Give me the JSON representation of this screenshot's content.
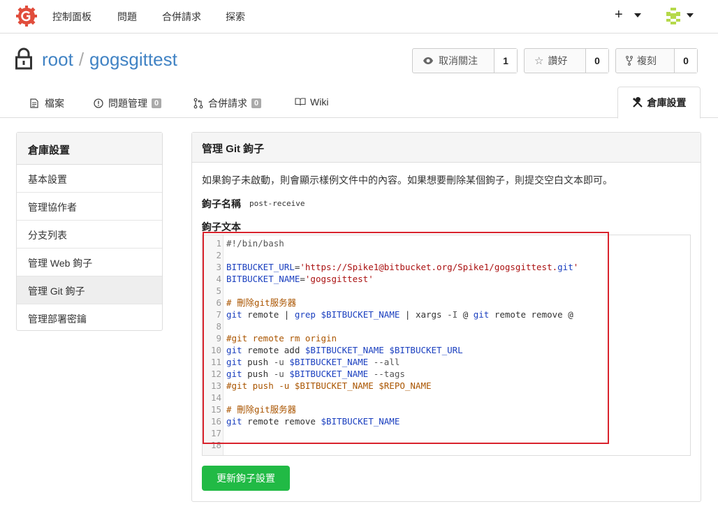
{
  "nav": {
    "items": [
      "控制面板",
      "問題",
      "合併請求",
      "探索"
    ],
    "plus_label": "+"
  },
  "repo": {
    "owner": "root",
    "separator": "/",
    "name": "gogsgittest",
    "watch": {
      "label": "取消關注",
      "count": "1"
    },
    "star": {
      "label": "讚好",
      "count": "0"
    },
    "fork": {
      "label": "複刻",
      "count": "0"
    }
  },
  "tabs": {
    "files": "檔案",
    "issues": "問題管理",
    "issues_count": "0",
    "pulls": "合併請求",
    "pulls_count": "0",
    "wiki": "Wiki",
    "settings": "倉庫設置"
  },
  "sidebar": {
    "title": "倉庫設置",
    "items": [
      "基本設置",
      "管理協作者",
      "分支列表",
      "管理 Web 鉤子",
      "管理 Git 鉤子",
      "管理部署密鑰"
    ],
    "active_index": 4
  },
  "panel": {
    "title": "管理 Git 鉤子",
    "description": "如果鉤子未啟動，則會顯示樣例文件中的內容。如果想要刪除某個鉤子，則提交空白文本即可。",
    "hook_name_label": "鉤子名稱",
    "hook_name": "post-receive",
    "hook_content_label": "鉤子文本",
    "update_button": "更新鉤子設置"
  },
  "editor": {
    "lines": [
      {
        "n": "1",
        "t": "#!/bin/bash"
      },
      {
        "n": "2",
        "t": ""
      },
      {
        "n": "3",
        "t": "BITBUCKET_URL='https://Spike1@bitbucket.org/Spike1/gogsgittest.git'"
      },
      {
        "n": "4",
        "t": "BITBUCKET_NAME='gogsgittest'"
      },
      {
        "n": "5",
        "t": ""
      },
      {
        "n": "6",
        "t": "# 刪除git服务器"
      },
      {
        "n": "7",
        "t": "git remote | grep $BITBUCKET_NAME | xargs -I @ git remote remove @"
      },
      {
        "n": "8",
        "t": ""
      },
      {
        "n": "9",
        "t": "#git remote rm origin"
      },
      {
        "n": "10",
        "t": "git remote add $BITBUCKET_NAME $BITBUCKET_URL"
      },
      {
        "n": "11",
        "t": "git push -u $BITBUCKET_NAME --all"
      },
      {
        "n": "12",
        "t": "git push -u $BITBUCKET_NAME --tags"
      },
      {
        "n": "13",
        "t": "#git push -u $BITBUCKET_NAME $REPO_NAME"
      },
      {
        "n": "14",
        "t": ""
      },
      {
        "n": "15",
        "t": "# 刪除git服务器"
      },
      {
        "n": "16",
        "t": "git remote remove $BITBUCKET_NAME"
      },
      {
        "n": "17",
        "t": ""
      },
      {
        "n": "18",
        "t": ""
      }
    ]
  },
  "colors": {
    "accent": "#4183c4",
    "highlight_box": "#d9232d",
    "primary_button": "#21ba45"
  }
}
